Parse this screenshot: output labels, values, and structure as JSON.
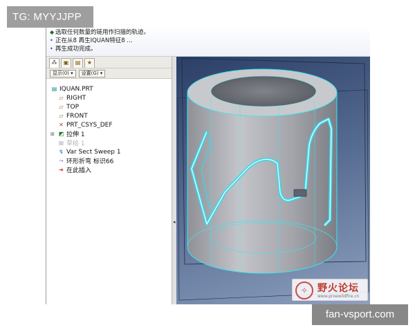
{
  "watermarks": {
    "top_left": "TG: MYYJJPP",
    "bottom_right": "fan-vsport.com"
  },
  "messages": [
    {
      "icon": "check-icon",
      "text": "选取任何数量的链用作扫描的轨迹。"
    },
    {
      "icon": "info-icon",
      "text": "正在从8 再生IQUAN特征8 ..."
    },
    {
      "icon": "info-icon",
      "text": "再生成功完成。"
    }
  ],
  "panel_tabs": [
    "model-tree-tab",
    "folder-tab",
    "layer-tab",
    "favorites-tab"
  ],
  "toolbar": {
    "show_label": "显示(0) ▾",
    "settings_label": "设置(G) ▾"
  },
  "model_tree": [
    {
      "label": "IQUAN.PRT",
      "icon": "part-icon",
      "level": 0,
      "faded": false,
      "expandable": false
    },
    {
      "label": "RIGHT",
      "icon": "datum-plane-icon",
      "level": 1,
      "faded": false,
      "expandable": false
    },
    {
      "label": "TOP",
      "icon": "datum-plane-icon",
      "level": 1,
      "faded": false,
      "expandable": false
    },
    {
      "label": "FRONT",
      "icon": "datum-plane-icon",
      "level": 1,
      "faded": false,
      "expandable": false
    },
    {
      "label": "PRT_CSYS_DEF",
      "icon": "csys-icon",
      "level": 1,
      "faded": false,
      "expandable": false
    },
    {
      "label": "拉伸 1",
      "icon": "extrude-icon",
      "level": 1,
      "faded": false,
      "expandable": true
    },
    {
      "label": "草绘 1",
      "icon": "sketch-icon",
      "level": 1,
      "faded": true,
      "expandable": false
    },
    {
      "label": "Var Sect Sweep 1",
      "icon": "sweep-icon",
      "level": 1,
      "faded": false,
      "expandable": false
    },
    {
      "label": "环形折弯 标识66",
      "icon": "toroidal-bend-icon",
      "level": 1,
      "faded": false,
      "expandable": false
    },
    {
      "label": "在此插入",
      "icon": "insert-here-icon",
      "level": 1,
      "faded": false,
      "expandable": false
    }
  ],
  "forum_logo": {
    "name": "野火论坛",
    "url": "www.proewildfire.cn"
  },
  "colors": {
    "viewport_top": "#2b3f66",
    "viewport_bottom": "#8da0bf",
    "model_edge": "#39e6f0",
    "model_body": "#a9a9ae"
  }
}
